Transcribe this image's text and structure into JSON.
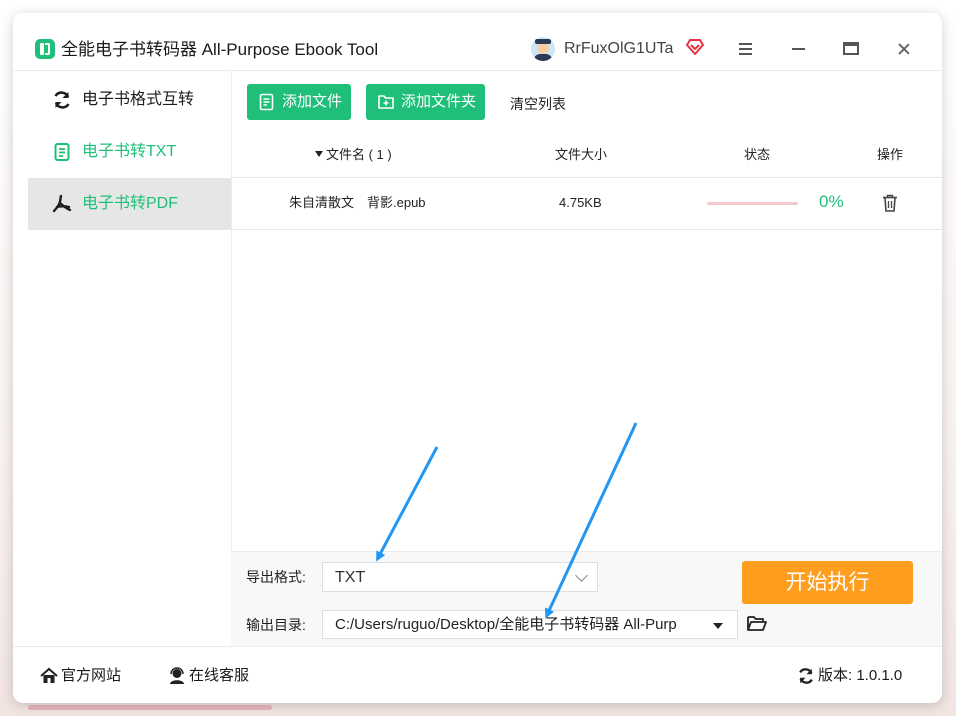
{
  "window": {
    "title": "全能电子书转码器 All-Purpose Ebook Tool",
    "username": "RrFuxOlG1UTa",
    "controls": [
      "menu",
      "minimize",
      "maximize",
      "close"
    ]
  },
  "sidebar": {
    "items": [
      {
        "label": "电子书格式互转",
        "icon": "refresh-icon"
      },
      {
        "label": "电子书转TXT",
        "icon": "document-icon"
      },
      {
        "label": "电子书转PDF",
        "icon": "pdf-icon",
        "active": true
      }
    ]
  },
  "toolbar": {
    "add_file": "添加文件",
    "add_folder": "添加文件夹",
    "clear_list": "清空列表"
  },
  "table": {
    "headers": {
      "filename": "文件名 ( 1 )",
      "size": "文件大小",
      "status": "状态",
      "action": "操作"
    },
    "rows": [
      {
        "filename": "朱自清散文　背影.epub",
        "size": "4.75KB",
        "progress": 0,
        "percent": "0%"
      }
    ]
  },
  "export": {
    "format_label": "导出格式:",
    "format_value": "TXT",
    "output_label": "输出目录:",
    "output_value": "C:/Users/ruguo/Desktop/全能电子书转码器 All-Purp",
    "start_button": "开始执行"
  },
  "footer": {
    "website": "官方网站",
    "support": "在线客服",
    "version": "版本: 1.0.1.0"
  },
  "colors": {
    "accent_green": "#1fbf7a",
    "start_orange": "#ff9d1e",
    "annotation_blue": "#2196f3"
  }
}
